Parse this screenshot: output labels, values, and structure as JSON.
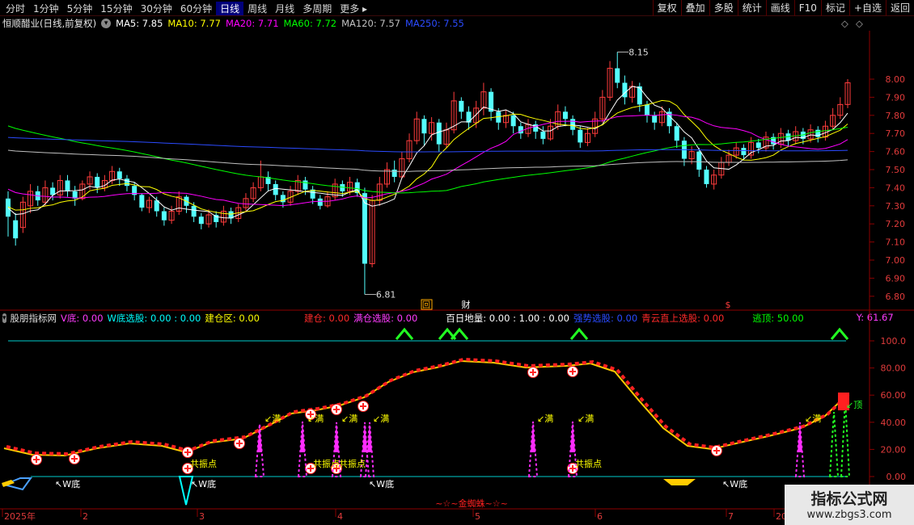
{
  "toolbar": {
    "periods": [
      "分时",
      "1分钟",
      "5分钟",
      "15分钟",
      "30分钟",
      "60分钟",
      "日线",
      "周线",
      "月线",
      "多周期",
      "更多 ▸"
    ],
    "active_period": "日线",
    "actions": [
      "复权",
      "叠加",
      "多股",
      "统计",
      "画线",
      "F10",
      "标记",
      "+自选",
      "返回"
    ]
  },
  "header": {
    "stock_name": "恒顺醋业(日线,前复权)",
    "ma": [
      {
        "label": "MA5: 7.85",
        "color": "#ffffff"
      },
      {
        "label": "MA10: 7.77",
        "color": "#ffff00"
      },
      {
        "label": "MA20: 7.71",
        "color": "#ff00ff"
      },
      {
        "label": "MA60: 7.72",
        "color": "#00ff00"
      },
      {
        "label": "MA120: 7.57",
        "color": "#c0c0c0"
      },
      {
        "label": "MA250: 7.55",
        "color": "#2b4bff"
      }
    ]
  },
  "price_axis": [
    "8.00",
    "7.90",
    "7.80",
    "7.70",
    "7.60",
    "7.50",
    "7.40",
    "7.30",
    "7.20",
    "7.10",
    "7.00",
    "6.90",
    "6.80"
  ],
  "price_annotations": {
    "high": "8.15",
    "low": "6.81",
    "marker_hui": "回",
    "marker_cai": "财",
    "marker_s": "$"
  },
  "indicator_header": {
    "name": "股朋指标网",
    "items": [
      {
        "text": "V底: 0.00",
        "color": "#ff3cff"
      },
      {
        "text": "W底选股: 0.00 : 0.00",
        "color": "#00ffff"
      },
      {
        "text": "建仓区: 0.00",
        "color": "#ffff00"
      },
      {
        "text": "建仓: 0.00",
        "color": "#ff2a2a"
      },
      {
        "text": "满仓选股: 0.00",
        "color": "#ff3cff"
      },
      {
        "text": "百日地量: 0.00 : 1.00 : 0.00",
        "color": "#ffffff"
      },
      {
        "text": "强势选股: 0.00",
        "color": "#2a4bff"
      },
      {
        "text": "青云直上选股: 0.00",
        "color": "#ff2a2a"
      },
      {
        "text": "逃顶: 50.00",
        "color": "#00ff00"
      },
      {
        "text": "Y: 61.67",
        "color": "#ff3cff"
      }
    ]
  },
  "indicator_axis": [
    "100.0",
    "80.00",
    "60.00",
    "40.00",
    "20.00",
    "0.00"
  ],
  "indicator_labels": {
    "w_bottom": "W底",
    "resonance": "共振点",
    "full": "满",
    "top": "顶",
    "brand": "~☆~金蜘蛛~☆~"
  },
  "date_axis": [
    "2025年",
    "2",
    "3",
    "4",
    "5",
    "6",
    "7",
    "20"
  ],
  "watermark": {
    "title": "指标公式网",
    "url": "www.zbgs3.com"
  },
  "chart_data": {
    "type": "candlestick",
    "ylim": [
      6.75,
      8.25
    ],
    "candles": [
      [
        7.34,
        7.24,
        7.38,
        7.13
      ],
      [
        7.22,
        7.12,
        7.26,
        7.08
      ],
      [
        7.18,
        7.32,
        7.35,
        7.15
      ],
      [
        7.3,
        7.38,
        7.42,
        7.26
      ],
      [
        7.38,
        7.33,
        7.41,
        7.3
      ],
      [
        7.32,
        7.4,
        7.44,
        7.3
      ],
      [
        7.4,
        7.36,
        7.43,
        7.33
      ],
      [
        7.36,
        7.44,
        7.47,
        7.34
      ],
      [
        7.44,
        7.38,
        7.47,
        7.35
      ],
      [
        7.38,
        7.34,
        7.41,
        7.3
      ],
      [
        7.34,
        7.42,
        7.44,
        7.33
      ],
      [
        7.42,
        7.46,
        7.49,
        7.39
      ],
      [
        7.46,
        7.4,
        7.48,
        7.37
      ],
      [
        7.4,
        7.44,
        7.47,
        7.38
      ],
      [
        7.44,
        7.49,
        7.52,
        7.42
      ],
      [
        7.49,
        7.45,
        7.51,
        7.41
      ],
      [
        7.45,
        7.41,
        7.47,
        7.38
      ],
      [
        7.41,
        7.36,
        7.43,
        7.33
      ],
      [
        7.36,
        7.29,
        7.37,
        7.27
      ],
      [
        7.29,
        7.33,
        7.35,
        7.26
      ],
      [
        7.33,
        7.27,
        7.35,
        7.24
      ],
      [
        7.27,
        7.22,
        7.29,
        7.19
      ],
      [
        7.22,
        7.27,
        7.3,
        7.2
      ],
      [
        7.27,
        7.35,
        7.38,
        7.25
      ],
      [
        7.35,
        7.3,
        7.36,
        7.26
      ],
      [
        7.3,
        7.24,
        7.32,
        7.21
      ],
      [
        7.24,
        7.2,
        7.26,
        7.17
      ],
      [
        7.2,
        7.25,
        7.28,
        7.18
      ],
      [
        7.25,
        7.21,
        7.27,
        7.18
      ],
      [
        7.21,
        7.27,
        7.3,
        7.19
      ],
      [
        7.27,
        7.23,
        7.29,
        7.2
      ],
      [
        7.23,
        7.29,
        7.31,
        7.21
      ],
      [
        7.29,
        7.34,
        7.37,
        7.27
      ],
      [
        7.34,
        7.4,
        7.43,
        7.32
      ],
      [
        7.4,
        7.46,
        7.55,
        7.38
      ],
      [
        7.46,
        7.42,
        7.49,
        7.38
      ],
      [
        7.42,
        7.36,
        7.44,
        7.33
      ],
      [
        7.36,
        7.32,
        7.38,
        7.29
      ],
      [
        7.32,
        7.38,
        7.41,
        7.3
      ],
      [
        7.38,
        7.44,
        7.47,
        7.36
      ],
      [
        7.44,
        7.39,
        7.46,
        7.36
      ],
      [
        7.39,
        7.34,
        7.41,
        7.31
      ],
      [
        7.34,
        7.3,
        7.36,
        7.28
      ],
      [
        7.3,
        7.35,
        7.38,
        7.29
      ],
      [
        7.35,
        7.42,
        7.45,
        7.33
      ],
      [
        7.42,
        7.38,
        7.44,
        7.35
      ],
      [
        7.38,
        7.43,
        7.46,
        7.36
      ],
      [
        7.43,
        7.37,
        7.45,
        7.35
      ],
      [
        7.37,
        6.98,
        7.4,
        6.81
      ],
      [
        6.98,
        7.33,
        7.36,
        6.96
      ],
      [
        7.33,
        7.42,
        7.46,
        7.3
      ],
      [
        7.42,
        7.5,
        7.54,
        7.4
      ],
      [
        7.5,
        7.46,
        7.55,
        7.43
      ],
      [
        7.46,
        7.56,
        7.6,
        7.45
      ],
      [
        7.56,
        7.66,
        7.7,
        7.54
      ],
      [
        7.66,
        7.78,
        7.82,
        7.64
      ],
      [
        7.78,
        7.7,
        7.8,
        7.63
      ],
      [
        7.7,
        7.76,
        7.79,
        7.66
      ],
      [
        7.76,
        7.64,
        7.78,
        7.6
      ],
      [
        7.64,
        7.72,
        7.76,
        7.62
      ],
      [
        7.72,
        7.88,
        7.93,
        7.7
      ],
      [
        7.88,
        7.82,
        7.9,
        7.78
      ],
      [
        7.82,
        7.76,
        7.85,
        7.72
      ],
      [
        7.76,
        7.84,
        7.88,
        7.73
      ],
      [
        7.84,
        7.93,
        7.98,
        7.8
      ],
      [
        7.93,
        7.82,
        7.95,
        7.77
      ],
      [
        7.82,
        7.76,
        7.84,
        7.72
      ],
      [
        7.76,
        7.8,
        7.83,
        7.73
      ],
      [
        7.8,
        7.74,
        7.82,
        7.7
      ],
      [
        7.74,
        7.7,
        7.76,
        7.67
      ],
      [
        7.7,
        7.75,
        7.78,
        7.68
      ],
      [
        7.75,
        7.71,
        7.77,
        7.67
      ],
      [
        7.71,
        7.67,
        7.74,
        7.64
      ],
      [
        7.67,
        7.74,
        7.78,
        7.66
      ],
      [
        7.74,
        7.82,
        7.86,
        7.72
      ],
      [
        7.82,
        7.78,
        7.85,
        7.74
      ],
      [
        7.78,
        7.72,
        7.8,
        7.69
      ],
      [
        7.72,
        7.65,
        7.74,
        7.62
      ],
      [
        7.65,
        7.7,
        7.73,
        7.63
      ],
      [
        7.7,
        7.78,
        7.82,
        7.68
      ],
      [
        7.78,
        7.9,
        7.94,
        7.76
      ],
      [
        7.9,
        8.06,
        8.1,
        7.88
      ],
      [
        8.06,
        7.98,
        8.15,
        7.95
      ],
      [
        7.98,
        7.9,
        8.02,
        7.86
      ],
      [
        7.9,
        7.96,
        7.99,
        7.87
      ],
      [
        7.96,
        7.86,
        7.98,
        7.82
      ],
      [
        7.86,
        7.8,
        7.88,
        7.76
      ],
      [
        7.8,
        7.76,
        7.82,
        7.72
      ],
      [
        7.76,
        7.82,
        7.85,
        7.74
      ],
      [
        7.82,
        7.74,
        7.84,
        7.7
      ],
      [
        7.74,
        7.66,
        7.76,
        7.62
      ],
      [
        7.66,
        7.56,
        7.68,
        7.52
      ],
      [
        7.56,
        7.6,
        7.63,
        7.53
      ],
      [
        7.6,
        7.5,
        7.62,
        7.46
      ],
      [
        7.5,
        7.42,
        7.52,
        7.4
      ],
      [
        7.42,
        7.47,
        7.5,
        7.39
      ],
      [
        7.47,
        7.54,
        7.57,
        7.45
      ],
      [
        7.54,
        7.58,
        7.61,
        7.52
      ],
      [
        7.58,
        7.62,
        7.65,
        7.56
      ],
      [
        7.62,
        7.58,
        7.64,
        7.55
      ],
      [
        7.58,
        7.65,
        7.68,
        7.56
      ],
      [
        7.65,
        7.62,
        7.67,
        7.59
      ],
      [
        7.62,
        7.68,
        7.71,
        7.6
      ],
      [
        7.68,
        7.64,
        7.7,
        7.61
      ],
      [
        7.64,
        7.7,
        7.73,
        7.62
      ],
      [
        7.7,
        7.66,
        7.72,
        7.63
      ],
      [
        7.66,
        7.71,
        7.74,
        7.64
      ],
      [
        7.71,
        7.67,
        7.73,
        7.64
      ],
      [
        7.67,
        7.72,
        7.75,
        7.65
      ],
      [
        7.72,
        7.68,
        7.74,
        7.65
      ],
      [
        7.68,
        7.74,
        7.77,
        7.66
      ],
      [
        7.74,
        7.8,
        7.84,
        7.72
      ],
      [
        7.8,
        7.86,
        7.9,
        7.78
      ],
      [
        7.86,
        7.98,
        8.0,
        7.84
      ]
    ],
    "series": [
      {
        "name": "MA5",
        "color": "#ffffff"
      },
      {
        "name": "MA10",
        "color": "#ffff00"
      },
      {
        "name": "MA20",
        "color": "#ff00ff"
      },
      {
        "name": "MA60",
        "color": "#00ff00"
      },
      {
        "name": "MA120",
        "color": "#c0c0c0"
      },
      {
        "name": "MA250",
        "color": "#2b4bff"
      }
    ]
  }
}
